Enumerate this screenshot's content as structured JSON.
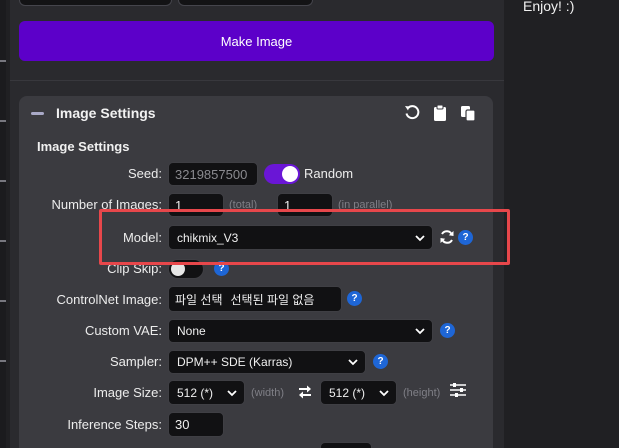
{
  "side_text": "Enjoy! :)",
  "make_button": "Make Image",
  "panel": {
    "title": "Image Settings",
    "subtitle": "Image Settings"
  },
  "seed": {
    "label": "Seed:",
    "value": "3219857500",
    "random_label": "Random",
    "random_on": true
  },
  "num_images": {
    "label": "Number of Images:",
    "total": "1",
    "total_hint": "(total)",
    "parallel": "1",
    "parallel_hint": "(in parallel)"
  },
  "model": {
    "label": "Model:",
    "value": "chikmix_V3"
  },
  "clip_skip": {
    "label": "Clip Skip:",
    "on": false
  },
  "controlnet": {
    "label": "ControlNet Image:",
    "file_button": "파일 선택",
    "file_status": "선택된 파일 없음"
  },
  "vae": {
    "label": "Custom VAE:",
    "value": "None"
  },
  "sampler": {
    "label": "Sampler:",
    "value": "DPM++ SDE (Karras)"
  },
  "image_size": {
    "label": "Image Size:",
    "width": "512 (*)",
    "width_hint": "(width)",
    "height": "512 (*)",
    "height_hint": "(height)"
  },
  "steps": {
    "label": "Inference Steps:",
    "value": "30"
  },
  "help_glyph": "?",
  "colors": {
    "accent": "#5c00c9",
    "toggle_on": "#6a16d6",
    "help": "#1e66d6",
    "highlight": "#e7474b"
  },
  "icons": [
    "reset-icon",
    "paste-icon",
    "copy-icon",
    "refresh-icon",
    "swap-icon",
    "sliders-icon",
    "chevron-down-icon",
    "minus-icon"
  ]
}
